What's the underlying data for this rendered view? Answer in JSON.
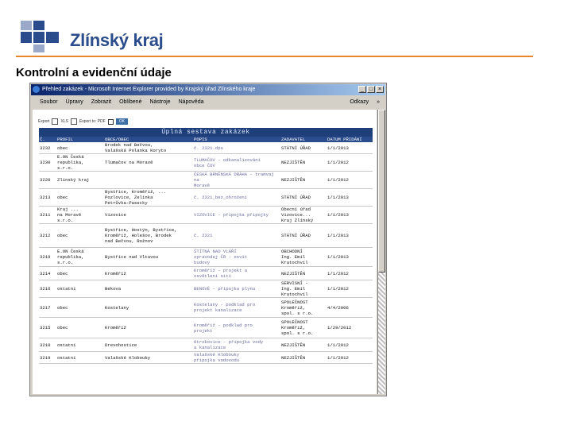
{
  "header": {
    "brand": "Zlínský kraj",
    "page_title": "Kontrolní a evidenční údaje",
    "accent_color": "#e8862a",
    "brand_color": "#2b4c8c"
  },
  "browser": {
    "window_title": "Přehled zakázek - Microsoft Internet Explorer provided by Krajský úřad Zlínského kraje",
    "menu": [
      "Soubor",
      "Úpravy",
      "Zobrazit",
      "Oblíbené",
      "Nástroje",
      "Nápověda"
    ],
    "links_label": "Odkazy",
    "chevron": "»",
    "window_buttons": [
      "_",
      "□",
      "×"
    ]
  },
  "report": {
    "export_label": "Export",
    "export_format_label": "XLS",
    "export_page_label": "Export to: PDF",
    "go_button": "OK",
    "title": "Úplná sestava zakázek",
    "columns": [
      "Č.",
      "PROFIL",
      "OBCE/OBEC",
      "POPIS",
      "ZADAVATEL",
      "DATUM PŘIDÁNÍ"
    ],
    "rows": [
      [
        "3232",
        "obec",
        "Brodek nad Bečvou,\nValašská Polanka Koryto",
        "č. 2321.dps",
        "STÁTNÍ ÚŘAD",
        "1/1/2013"
      ],
      [
        "3230",
        "E.ON Česká\nrepublika,\ns.r.o.",
        "Tlumačov na Moravě",
        "TLUMAČOV - odkanalizování\nobce ČOV",
        "NEZJIŠTĚN",
        "1/1/2012"
      ],
      [
        "3220",
        "Zlínský kraj",
        "",
        "ČESKÁ BRNĚNSKÁ DRÁHA - tramvaj na\nMoravě",
        "NEZJIŠTĚN",
        "1/1/2012"
      ],
      [
        "3213",
        "obec",
        "Bystřice, Kroměříž, ...\nPozlovice, Zelinka\nPetrůvka-Pasecky",
        "č. 2321_bez_ohrožení",
        "STÁTNÍ ÚŘAD",
        "1/1/2013"
      ],
      [
        "3211",
        "Kraj ...\nna Moravě\ns.r.o.",
        "Vizovice",
        "VIZOVICE - přípojka přípojky",
        "Obecní úřad\nVizovice...\nKraj Zlínský",
        "1/1/2013"
      ],
      [
        "3212",
        "obec",
        "Bystřice, Hostýn, Bystřice,\nKroměříž, Holešov, Brodek\nnad Bečvou, Rožnov",
        "č. 2321",
        "STÁTNÍ ÚŘAD",
        "1/1/2013"
      ],
      [
        "3219",
        "E.ON Česká\nrepublika,\ns.r.o.",
        "Bystřice nad Vltavou",
        "ŠTÍTNÁ NAD VLÁŘÍ\nzpravodaj ČR - osvit\nbudovy",
        "OBCHODNÍ\nIng. Emil\nKratochvíl",
        "1/1/2013"
      ],
      [
        "3214",
        "obec",
        "Kroměříž",
        "Kroměříž - projekt a\nosvětlení sítí",
        "NEZJIŠTĚN",
        "1/1/2012"
      ],
      [
        "3216",
        "ostatní",
        "Bekova",
        "BENOVÉ - přípojka plynu",
        "SERVISNÍ -\nIng. Emil\nKratochvíl",
        "1/1/2012"
      ],
      [
        "3217",
        "obec",
        "Kostelany",
        "Kostelany - podklad pro\nprojekt kanalizace",
        "SPOLEČNOST\nKroměříž,\nspol. s r.o.",
        "4/4/2006"
      ],
      [
        "3215",
        "obec",
        "Kroměříž",
        "Kroměříž - podklad pro\nprojekt",
        "SPOLEČNOST\nKroměříž,\nspol. s r.o.",
        "1/29/2012"
      ],
      [
        "3210",
        "ostatní",
        "Drevohostice",
        "Otrokovice - připojka vody\na kanalizace",
        "NEZJIŠTĚN",
        "1/1/2012"
      ],
      [
        "3219",
        "ostatní",
        "Valašské Klobouky",
        "Valašské Klobouky\npřípojka vodovodu",
        "NEZJIŠTĚN",
        "1/1/2012"
      ]
    ]
  }
}
